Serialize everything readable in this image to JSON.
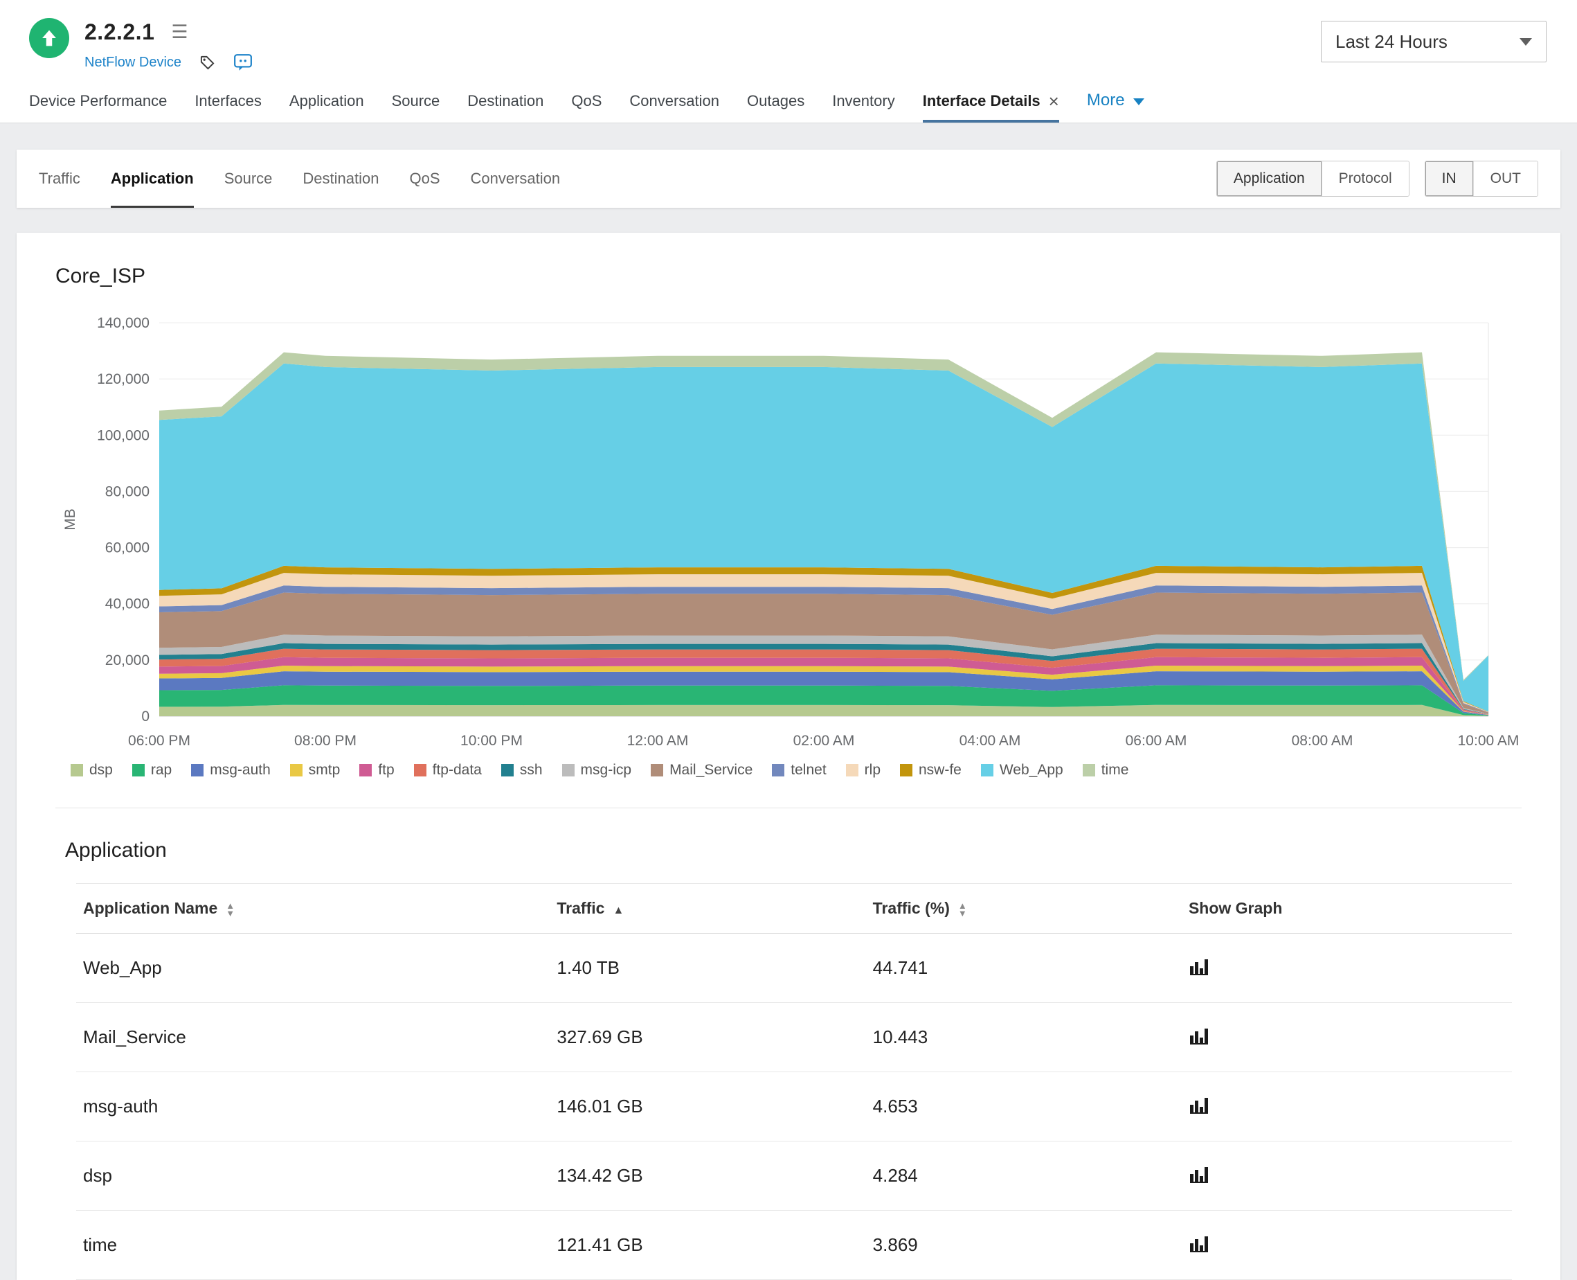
{
  "icons": {
    "menu": "☰",
    "close": "×",
    "sort_asc": "▲",
    "sort_desc": "▼"
  },
  "header": {
    "device_title": "2.2.2.1",
    "device_type_link": "NetFlow Device",
    "time_range_selected": "Last 24 Hours"
  },
  "main_tabs": {
    "items": [
      "Device Performance",
      "Interfaces",
      "Application",
      "Source",
      "Destination",
      "QoS",
      "Conversation",
      "Outages",
      "Inventory",
      "Interface Details"
    ],
    "active": "Interface Details",
    "more_label": "More"
  },
  "toolbar": {
    "tabs": [
      "Traffic",
      "Application",
      "Source",
      "Destination",
      "QoS",
      "Conversation"
    ],
    "active_tab": "Application",
    "metric_toggle": {
      "options": [
        "Application",
        "Protocol"
      ],
      "selected": "Application"
    },
    "direction_toggle": {
      "options": [
        "IN",
        "OUT"
      ],
      "selected": "IN"
    }
  },
  "chart_data": {
    "type": "area",
    "title": "Core_ISP",
    "ylabel": "MB",
    "y_max": 140000,
    "y_ticks": [
      0,
      20000,
      40000,
      60000,
      80000,
      100000,
      120000,
      140000
    ],
    "x_range": [
      0,
      16
    ],
    "x_ticks": [
      0,
      2,
      4,
      6,
      8,
      10,
      12,
      14,
      16
    ],
    "x_tick_labels": [
      "06:00 PM",
      "08:00 PM",
      "10:00 PM",
      "12:00 AM",
      "02:00 AM",
      "04:00 AM",
      "06:00 AM",
      "08:00 AM",
      "10:00 AM"
    ],
    "grid": true,
    "legend_position": "bottom",
    "x": [
      0,
      0.75,
      1.5,
      2,
      4,
      6,
      8,
      9.5,
      10.75,
      12,
      14,
      15.2,
      15.7,
      16
    ],
    "series": [
      {
        "name": "dsp",
        "color": "#b6c98f",
        "values": [
          3360,
          3400,
          4000,
          3960,
          3920,
          3960,
          3960,
          3920,
          3280,
          4000,
          3960,
          4000,
          400,
          120
        ]
      },
      {
        "name": "rap",
        "color": "#29b574",
        "values": [
          5880,
          5950,
          7000,
          6930,
          6860,
          6930,
          6930,
          6860,
          5740,
          7000,
          6930,
          7000,
          700,
          210
        ]
      },
      {
        "name": "msg-auth",
        "color": "#5b79c1",
        "values": [
          4200,
          4250,
          5000,
          4950,
          4900,
          4950,
          4950,
          4900,
          4100,
          5000,
          4950,
          5000,
          500,
          150
        ]
      },
      {
        "name": "smtp",
        "color": "#e9c844",
        "values": [
          1680,
          1700,
          2000,
          1980,
          1960,
          1980,
          1980,
          1960,
          1640,
          2000,
          1980,
          2000,
          200,
          60
        ]
      },
      {
        "name": "ftp",
        "color": "#cf5b93",
        "values": [
          2520,
          2550,
          3000,
          2970,
          2940,
          2970,
          2970,
          2940,
          2460,
          3000,
          2970,
          3000,
          300,
          90
        ]
      },
      {
        "name": "ftp-data",
        "color": "#e0705c",
        "values": [
          2520,
          2550,
          3000,
          2970,
          2940,
          2970,
          2970,
          2940,
          2460,
          3000,
          2970,
          3000,
          300,
          90
        ]
      },
      {
        "name": "ssh",
        "color": "#22808f",
        "values": [
          1680,
          1700,
          2000,
          1980,
          1960,
          1980,
          1980,
          1960,
          1640,
          2000,
          1980,
          2000,
          200,
          60
        ]
      },
      {
        "name": "msg-icp",
        "color": "#bcbcbc",
        "values": [
          2520,
          2550,
          3000,
          2970,
          2940,
          2970,
          2970,
          2940,
          2460,
          3000,
          2970,
          3000,
          300,
          90
        ]
      },
      {
        "name": "Mail_Service",
        "color": "#b08d79",
        "values": [
          12600,
          12750,
          15000,
          14850,
          14700,
          14850,
          14850,
          14700,
          12300,
          15000,
          14850,
          15000,
          1500,
          450
        ]
      },
      {
        "name": "telnet",
        "color": "#7288bd",
        "values": [
          2100,
          2130,
          2500,
          2480,
          2450,
          2480,
          2480,
          2450,
          2050,
          2500,
          2480,
          2500,
          250,
          80
        ]
      },
      {
        "name": "rlp",
        "color": "#f5d9b9",
        "values": [
          3780,
          3830,
          4500,
          4460,
          4410,
          4460,
          4460,
          4410,
          3690,
          4500,
          4460,
          4500,
          450,
          140
        ]
      },
      {
        "name": "nsw-fe",
        "color": "#c2950d",
        "values": [
          2100,
          2130,
          2500,
          2480,
          2450,
          2480,
          2480,
          2450,
          2050,
          2500,
          2480,
          2500,
          250,
          80
        ]
      },
      {
        "name": "Web_App",
        "color": "#66cfe6",
        "values": [
          60480,
          61200,
          72000,
          71280,
          70560,
          71280,
          71280,
          70560,
          59040,
          72000,
          71280,
          72000,
          7200,
          20000
        ]
      },
      {
        "name": "time",
        "color": "#bccfa8",
        "values": [
          3360,
          3400,
          4000,
          3960,
          3920,
          3960,
          3960,
          3920,
          3280,
          4000,
          3960,
          4000,
          400,
          120
        ]
      }
    ]
  },
  "table": {
    "title": "Application",
    "columns": [
      {
        "label": "Application Name",
        "sort": "both"
      },
      {
        "label": "Traffic",
        "sort": "asc"
      },
      {
        "label": "Traffic (%)",
        "sort": "both"
      },
      {
        "label": "Show Graph",
        "sort": "none"
      }
    ],
    "rows": [
      {
        "name": "Web_App",
        "traffic": "1.40 TB",
        "traffic_pct": "44.741"
      },
      {
        "name": "Mail_Service",
        "traffic": "327.69 GB",
        "traffic_pct": "10.443"
      },
      {
        "name": "msg-auth",
        "traffic": "146.01 GB",
        "traffic_pct": "4.653"
      },
      {
        "name": "dsp",
        "traffic": "134.42 GB",
        "traffic_pct": "4.284"
      },
      {
        "name": "time",
        "traffic": "121.41 GB",
        "traffic_pct": "3.869"
      }
    ]
  }
}
